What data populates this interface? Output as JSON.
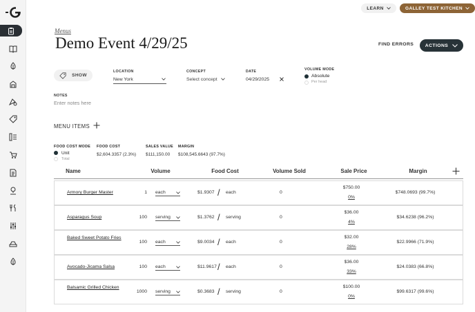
{
  "nav": {
    "items": [
      {
        "icon": "clipboard-icon",
        "active": true
      },
      {
        "icon": "book-icon"
      },
      {
        "icon": "lightbulb-icon"
      },
      {
        "icon": "inventory-icon"
      },
      {
        "icon": "recipe-icon"
      },
      {
        "icon": "tag-icon"
      },
      {
        "icon": "list-icon"
      },
      {
        "icon": "cart-icon"
      },
      {
        "icon": "report-icon"
      },
      {
        "icon": "location-icon"
      },
      {
        "icon": "utensils-icon"
      },
      {
        "icon": "sliders-icon"
      },
      {
        "icon": "scale-icon"
      },
      {
        "icon": "idea-icon"
      }
    ]
  },
  "header": {
    "learn_label": "LEARN",
    "kitchen_label": "GALLEY TEST KITCHEN",
    "breadcrumb": "Menus",
    "title": "Demo Event 4/29/25",
    "find_errors": "FIND ERRORS",
    "actions": "ACTIONS"
  },
  "filters": {
    "show_label": "SHOW",
    "location_label": "LOCATION",
    "location_value": "New York",
    "concept_label": "CONCEPT",
    "concept_placeholder": "Select concept",
    "date_label": "DATE",
    "date_value": "04/29/2025",
    "volume_mode_label": "VOLUME MODE",
    "volume_mode_options": [
      "Absolute",
      "Per head"
    ],
    "volume_mode_selected": "Absolute",
    "notes_label": "NOTES",
    "notes_placeholder": "Enter notes here"
  },
  "menu_items_label": "MENU ITEMS",
  "summary": {
    "food_cost_mode_label": "FOOD COST MODE",
    "food_cost_mode_options": [
      "Unit",
      "Total"
    ],
    "food_cost_mode_selected": "Unit",
    "food_cost_label": "FOOD COST",
    "food_cost_value": "$2,604.3357 (2.3%)",
    "sales_value_label": "SALES VALUE",
    "sales_value_value": "$111,150.00",
    "margin_label": "MARGIN",
    "margin_value": "$108,545.6643 (97.7%)"
  },
  "table": {
    "columns": [
      "Name",
      "Volume",
      "Food Cost",
      "Volume Sold",
      "Sale Price",
      "Margin"
    ],
    "rows": [
      {
        "name": "Armory Burger Master",
        "volume": "1",
        "unit": "each",
        "food_cost": "$1.9307",
        "food_cost_unit": "each",
        "volume_sold": "0",
        "sale_price": "$750.00",
        "sale_pct": "0%",
        "margin": "$748.0693 (99.7%)"
      },
      {
        "name": "Asparagus Soup",
        "volume": "100",
        "unit": "serving",
        "food_cost": "$1.3762",
        "food_cost_unit": "serving",
        "volume_sold": "0",
        "sale_price": "$36.00",
        "sale_pct": "4%",
        "margin": "$34.6238 (96.2%)"
      },
      {
        "name": "Baked Sweet Potato Fries",
        "volume": "100",
        "unit": "each",
        "food_cost": "$9.0034",
        "food_cost_unit": "each",
        "volume_sold": "0",
        "sale_price": "$32.00",
        "sale_pct": "28%",
        "margin": "$22.9966 (71.9%)"
      },
      {
        "name": "Avocado-Jicama Salsa",
        "volume": "100",
        "unit": "each",
        "food_cost": "$11.9617",
        "food_cost_unit": "each",
        "volume_sold": "0",
        "sale_price": "$36.00",
        "sale_pct": "33%",
        "margin": "$24.0383 (66.8%)"
      },
      {
        "name": "Balsamic Grilled Chicken",
        "volume": "1000",
        "unit": "serving",
        "food_cost": "$0.3683",
        "food_cost_unit": "serving",
        "volume_sold": "0",
        "sale_price": "$100.00",
        "sale_pct": "0%",
        "margin": "$99.6317 (99.6%)"
      }
    ]
  },
  "colors": {
    "accent": "#283338",
    "brand": "#8d6436",
    "active_nav": "#2a2f34"
  }
}
